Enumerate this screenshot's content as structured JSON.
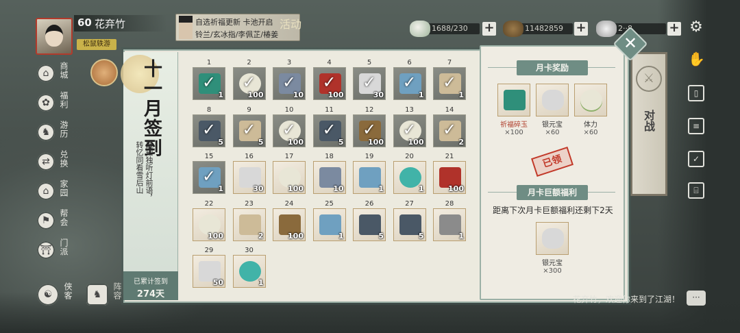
{
  "player": {
    "level": "60",
    "name": "花弃竹",
    "badge": "松鼠轶游"
  },
  "banner": {
    "line1": "自选祈福更新  卡池开启",
    "line2": "铃兰/玄冰指/李佩芷/椿姜",
    "tag": "活动"
  },
  "currency": [
    {
      "icon": "stamina-icon",
      "value": "1688/230"
    },
    {
      "icon": "copper-icon",
      "value": "11482859"
    },
    {
      "icon": "silver-ingot-icon",
      "value": "2··8"
    }
  ],
  "nav": [
    {
      "label": "商城",
      "icon": "shop-icon",
      "glyph": "⌂"
    },
    {
      "label": "福利",
      "icon": "gift-icon",
      "glyph": "✿"
    },
    {
      "label": "游历",
      "icon": "horse-icon",
      "glyph": "♞"
    },
    {
      "label": "兑换",
      "icon": "exchange-icon",
      "glyph": "⇄"
    },
    {
      "label": "家园",
      "icon": "home-icon",
      "glyph": "⌂"
    },
    {
      "label": "帮会",
      "icon": "guild-icon",
      "glyph": "⚑"
    },
    {
      "label": "门派",
      "icon": "sect-icon",
      "glyph": "⛩"
    }
  ],
  "xiake": {
    "label": "侠客"
  },
  "zhenrong": {
    "label": "阵容"
  },
  "signin": {
    "title": "十一月签到",
    "poem": [
      "遥知独听灯前语，",
      "转忆同看雪后山"
    ],
    "total_label": "已累计签到",
    "total_days": "274天"
  },
  "days": [
    {
      "day": "1",
      "qty": "1",
      "done": true,
      "item": "jade"
    },
    {
      "day": "2",
      "qty": "100",
      "done": true,
      "item": "bun"
    },
    {
      "day": "3",
      "qty": "10",
      "done": true,
      "item": "card"
    },
    {
      "day": "4",
      "qty": "100",
      "done": true,
      "item": "red"
    },
    {
      "day": "5",
      "qty": "30",
      "done": true,
      "item": "silver"
    },
    {
      "day": "6",
      "qty": "1",
      "done": true,
      "item": "crystal"
    },
    {
      "day": "7",
      "qty": "1",
      "done": true,
      "item": "scroll"
    },
    {
      "day": "8",
      "qty": "5",
      "done": true,
      "item": "chest"
    },
    {
      "day": "9",
      "qty": "5",
      "done": true,
      "item": "scroll"
    },
    {
      "day": "10",
      "qty": "100",
      "done": true,
      "item": "bun"
    },
    {
      "day": "11",
      "qty": "5",
      "done": true,
      "item": "chest"
    },
    {
      "day": "12",
      "qty": "100",
      "done": true,
      "item": "pouch"
    },
    {
      "day": "13",
      "qty": "100",
      "done": true,
      "item": "bun"
    },
    {
      "day": "14",
      "qty": "2",
      "done": true,
      "item": "scroll"
    },
    {
      "day": "15",
      "qty": "1",
      "done": true,
      "item": "crystal"
    },
    {
      "day": "16",
      "qty": "30",
      "done": false,
      "item": "silver"
    },
    {
      "day": "17",
      "qty": "100",
      "done": false,
      "item": "bun"
    },
    {
      "day": "18",
      "qty": "10",
      "done": false,
      "item": "card"
    },
    {
      "day": "19",
      "qty": "1",
      "done": false,
      "item": "crystal"
    },
    {
      "day": "20",
      "qty": "1",
      "done": false,
      "item": "orb"
    },
    {
      "day": "21",
      "qty": "100",
      "done": false,
      "item": "red"
    },
    {
      "day": "22",
      "qty": "100",
      "done": false,
      "item": "bun"
    },
    {
      "day": "23",
      "qty": "2",
      "done": false,
      "item": "scroll"
    },
    {
      "day": "24",
      "qty": "100",
      "done": false,
      "item": "pouch"
    },
    {
      "day": "25",
      "qty": "1",
      "done": false,
      "item": "crystal"
    },
    {
      "day": "26",
      "qty": "5",
      "done": false,
      "item": "chest"
    },
    {
      "day": "27",
      "qty": "5",
      "done": false,
      "item": "chest"
    },
    {
      "day": "28",
      "qty": "1",
      "done": false,
      "item": "hammer"
    },
    {
      "day": "29",
      "qty": "50",
      "done": false,
      "item": "silver"
    },
    {
      "day": "30",
      "qty": "1",
      "done": false,
      "item": "orb"
    }
  ],
  "monthly_card": {
    "title": "月卡奖励",
    "rewards": [
      {
        "name": "祈福碎玉",
        "count": "×100",
        "item": "jade"
      },
      {
        "name": "银元宝",
        "count": "×60",
        "item": "silver"
      },
      {
        "name": "体力",
        "count": "×60",
        "item": "bun"
      }
    ],
    "stamp": "已领",
    "bonus_title": "月卡巨额福利",
    "notice": "距离下次月卡巨额福利还剩下2天",
    "bonus_reward": {
      "name": "银元宝",
      "count": "×300",
      "item": "silver"
    }
  },
  "scroll": {
    "label": "对战"
  },
  "chat": {
    "text": "花弃竹，欢迎你来到了江湖！"
  },
  "item_colors": {
    "jade": "#2f8f7a",
    "bun": "#e8e6d6",
    "card": "#7b8aa0",
    "red": "#b0322a",
    "silver": "#d8d8d8",
    "crystal": "#6fa0c0",
    "scroll": "#cdbb98",
    "chest": "#4a5866",
    "pouch": "#8a6a3c",
    "orb": "#41b3a8",
    "hammer": "#8b8b8b"
  }
}
